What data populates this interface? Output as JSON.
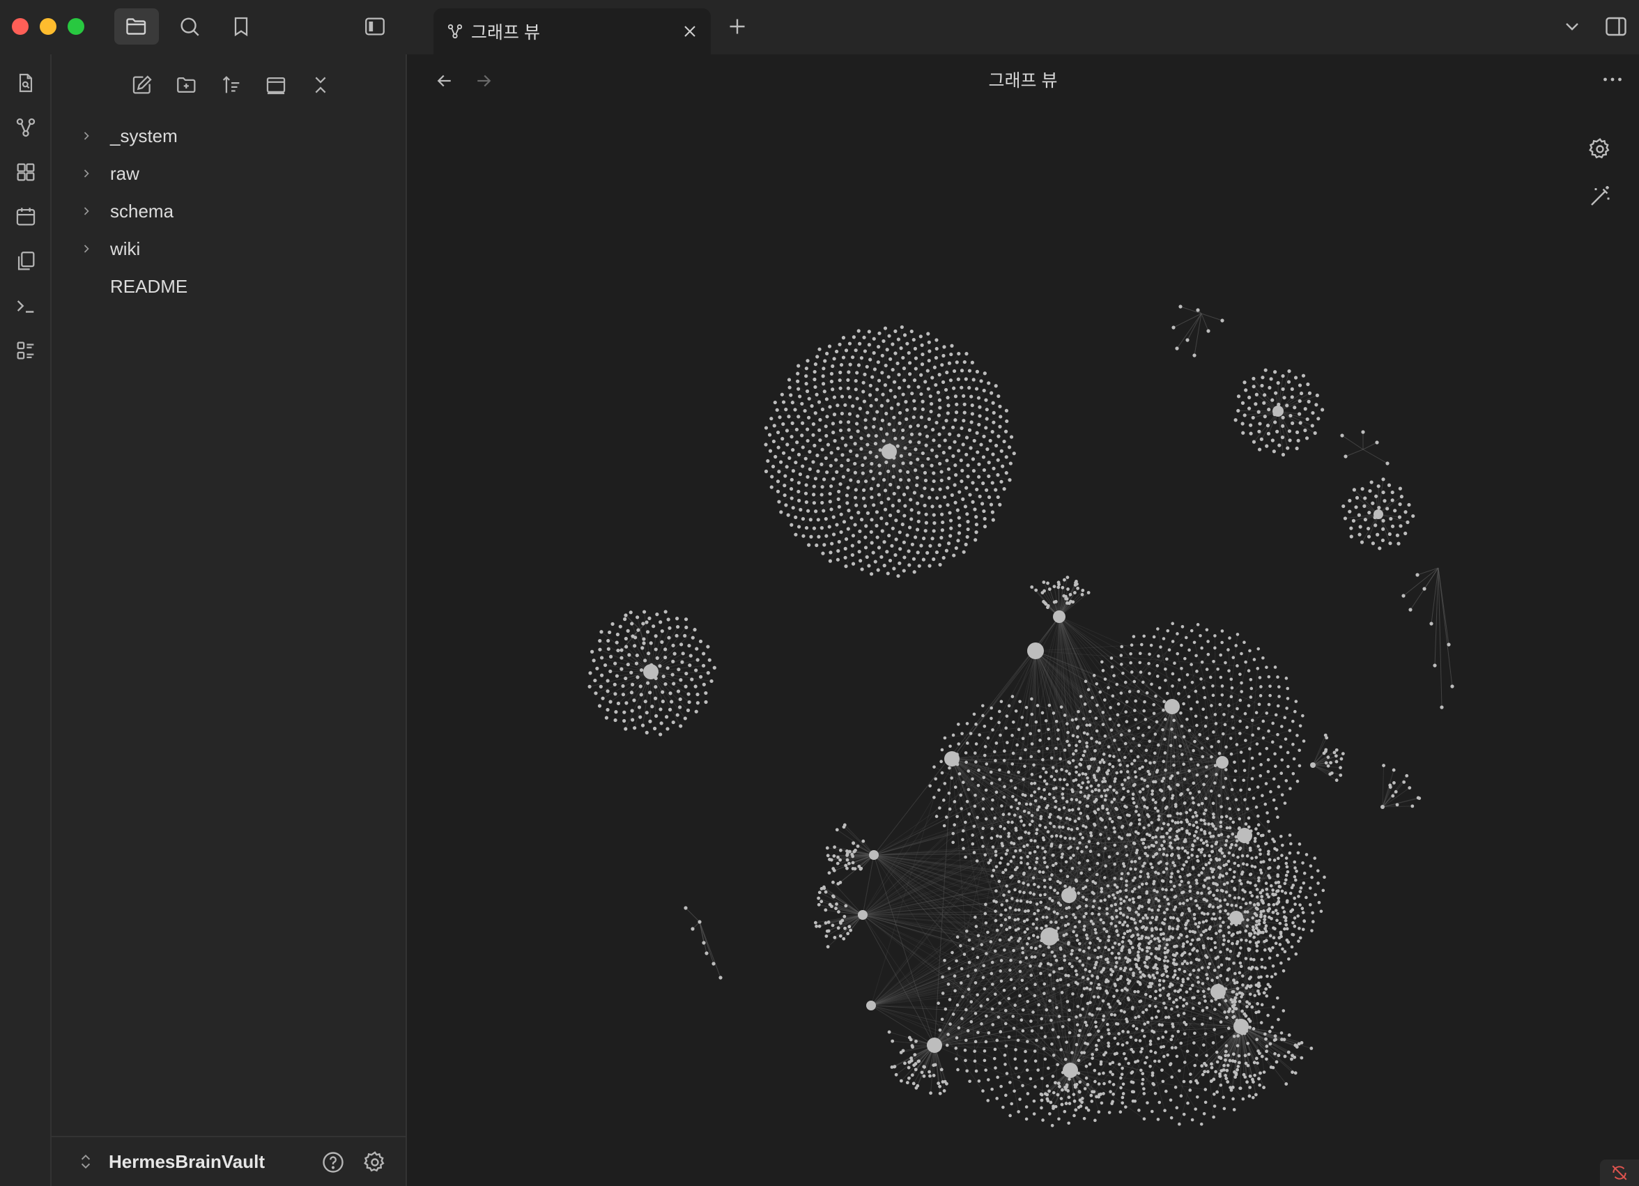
{
  "colors": {
    "traffic_red": "#fe5f57",
    "traffic_yellow": "#febc2e",
    "traffic_green": "#28c840",
    "node": "#bdbdbd",
    "edge": "#5c5c5c",
    "warning": "#e0544f"
  },
  "titlebar": {
    "icons": [
      "folder-icon",
      "search-icon",
      "bookmark-icon",
      "sidebar-toggle-icon"
    ],
    "right_icons": [
      "chevron-down-icon",
      "right-sidebar-toggle-icon"
    ]
  },
  "tab": {
    "icon": "graph-icon",
    "label": "그래프 뷰",
    "close_icon": "close-icon",
    "new_tab_icon": "plus-icon"
  },
  "ribbon": {
    "items": [
      "file-search-icon",
      "graph-icon",
      "grid-icon",
      "calendar-icon",
      "copy-icon",
      "terminal-icon",
      "list-icon"
    ]
  },
  "sidebar": {
    "toolbar": [
      "new-note-icon",
      "new-folder-icon",
      "sort-icon",
      "collapse-view-icon",
      "collapse-all-icon"
    ],
    "tree": [
      {
        "label": "_system",
        "folder": true
      },
      {
        "label": "raw",
        "folder": true
      },
      {
        "label": "schema",
        "folder": true
      },
      {
        "label": "wiki",
        "folder": true
      },
      {
        "label": "README",
        "folder": false
      }
    ],
    "vault_name": "HermesBrainVault",
    "vault_icons": [
      "vault-switch-icon",
      "help-icon",
      "settings-icon"
    ]
  },
  "main": {
    "title": "그래프 뷰",
    "nav": [
      "back-arrow-icon",
      "forward-arrow-icon"
    ],
    "more_icon": "more-icon",
    "graph_controls": [
      "graph-settings-icon",
      "magic-wand-icon"
    ]
  }
}
